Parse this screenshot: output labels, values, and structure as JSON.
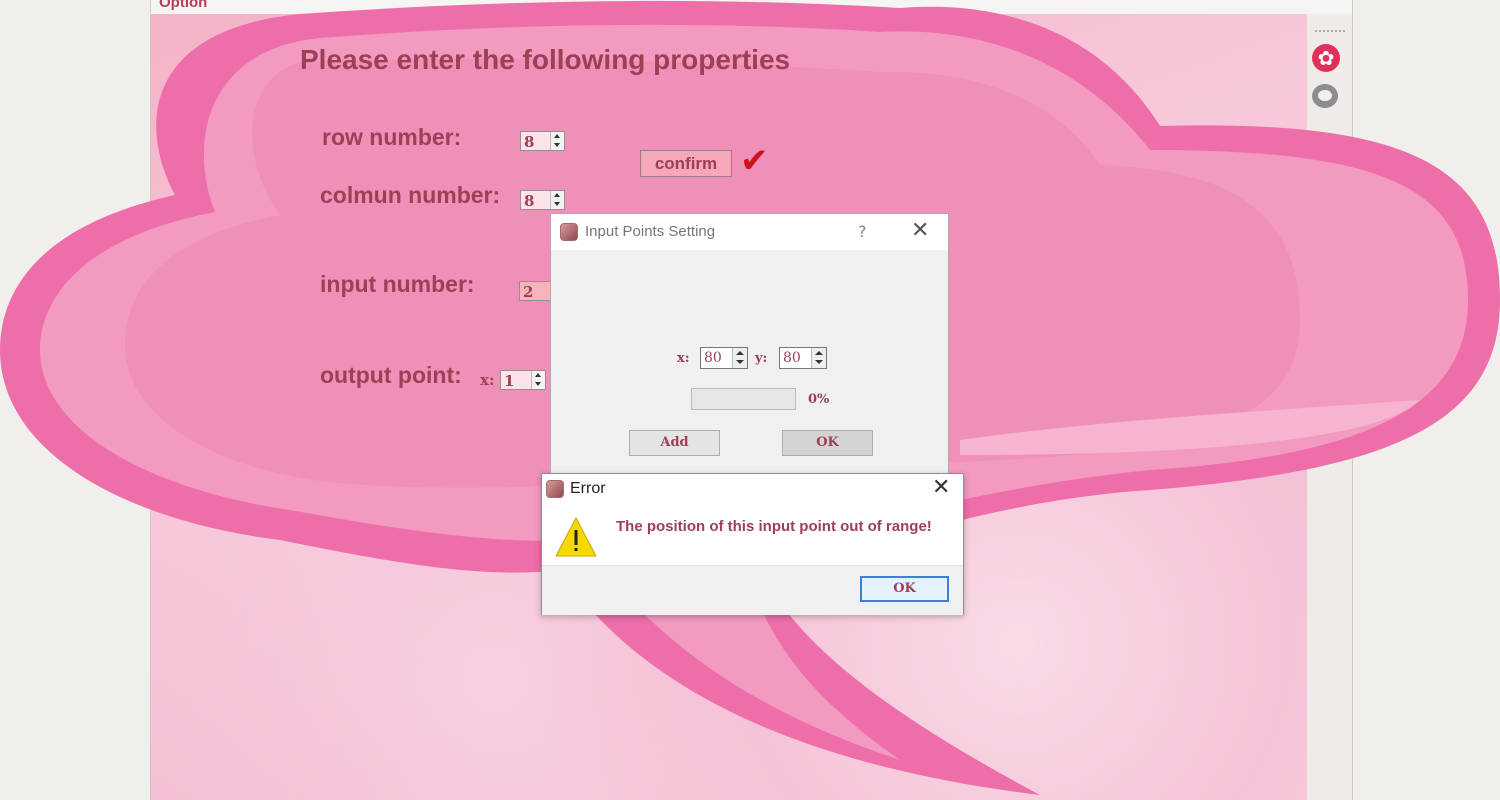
{
  "window": {
    "title": "Option"
  },
  "form": {
    "heading": "Please enter the following properties",
    "row_label": "row number:",
    "row_value": "8",
    "column_label": "colmun number:",
    "column_value": "8",
    "confirm_label": "confirm",
    "input_label": "input number:",
    "input_value": "2",
    "output_label": "output point:",
    "output_x_label": "x:",
    "output_x_value": "1"
  },
  "input_dialog": {
    "title": "Input Points Setting",
    "help": "?",
    "x_label": "x:",
    "x_value": "80",
    "y_label": "y:",
    "y_value": "80",
    "progress_text": "0%",
    "progress_value": 0,
    "add_label": "Add",
    "ok_label": "OK"
  },
  "error_dialog": {
    "title": "Error",
    "message": "The position of this input point out of range!",
    "ok_label": "OK"
  },
  "icons": {
    "settings": "gear-icon",
    "chat": "chat-bubble-icon",
    "confirmed": "checkmark-icon",
    "warning": "warning-icon"
  },
  "colors": {
    "accent": "#9d3f55",
    "bubble": "#f090b8",
    "check": "#d0101c"
  }
}
